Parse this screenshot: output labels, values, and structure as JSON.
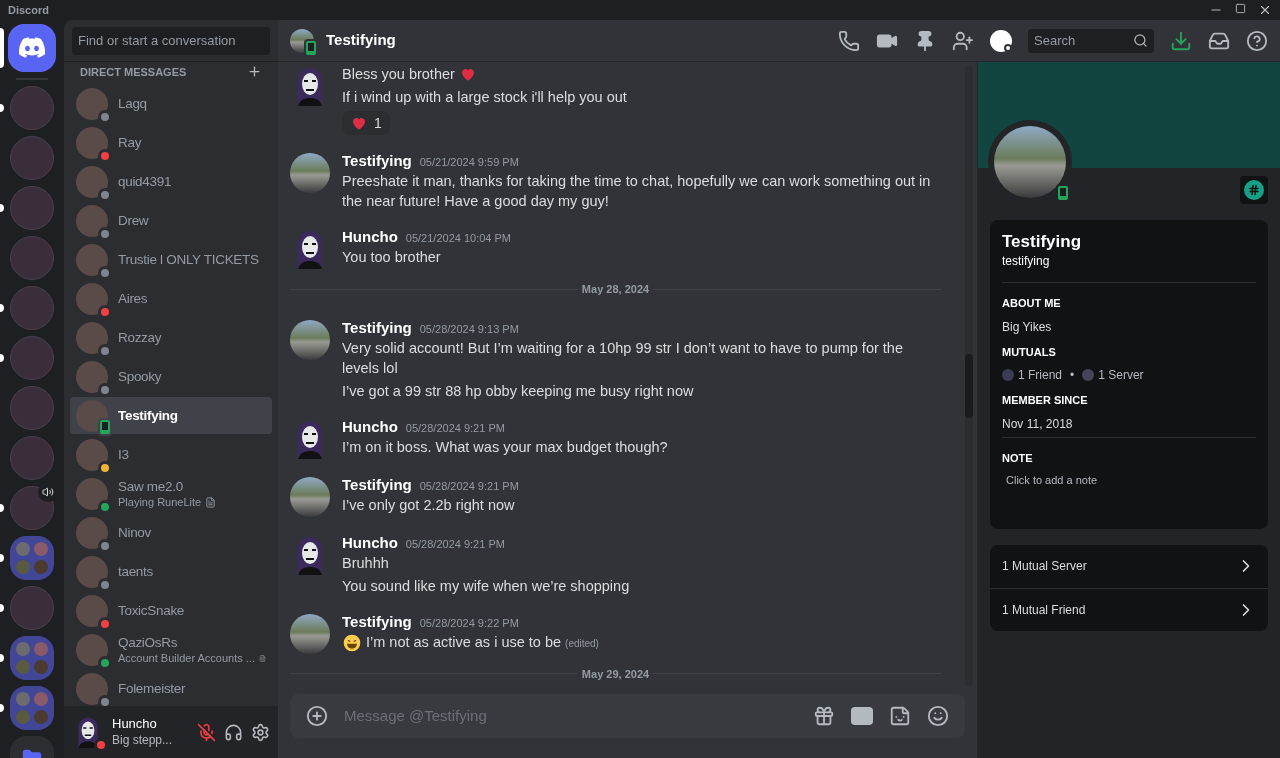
{
  "app_title": "Discord",
  "servers": [
    {
      "kind": "home",
      "selected": true,
      "unread": false,
      "voice": false
    },
    {
      "kind": "server",
      "selected": false,
      "unread": true,
      "voice": false
    },
    {
      "kind": "server",
      "selected": false,
      "unread": false,
      "voice": false
    },
    {
      "kind": "server",
      "selected": false,
      "unread": true,
      "voice": false
    },
    {
      "kind": "server",
      "selected": false,
      "unread": false,
      "voice": false
    },
    {
      "kind": "server",
      "selected": false,
      "unread": true,
      "voice": false
    },
    {
      "kind": "server",
      "selected": false,
      "unread": true,
      "voice": false
    },
    {
      "kind": "server",
      "selected": false,
      "unread": false,
      "voice": false
    },
    {
      "kind": "server",
      "selected": false,
      "unread": false,
      "voice": false
    },
    {
      "kind": "server",
      "selected": false,
      "unread": true,
      "voice": true
    },
    {
      "kind": "folder",
      "selected": false,
      "unread": true,
      "voice": false
    },
    {
      "kind": "server",
      "selected": false,
      "unread": true,
      "voice": false
    },
    {
      "kind": "folder",
      "selected": false,
      "unread": true,
      "voice": false
    },
    {
      "kind": "folder",
      "selected": false,
      "unread": true,
      "voice": false
    },
    {
      "kind": "closed-folder",
      "selected": false,
      "unread": false,
      "voice": false
    }
  ],
  "dm_search": {
    "placeholder": "Find or start a conversation"
  },
  "dm_header": "DIRECT MESSAGES",
  "dms": [
    {
      "name": "Lagq",
      "color": "#80848e",
      "on_mobile": false,
      "selected": false
    },
    {
      "name": "Ray",
      "color": "#f23f43",
      "on_mobile": false,
      "selected": false
    },
    {
      "name": "quid4391",
      "color": "#80848e",
      "on_mobile": false,
      "selected": false
    },
    {
      "name": "Drew",
      "color": "#80848e",
      "on_mobile": false,
      "selected": false
    },
    {
      "name": "Trustie l ONLY TICKETS",
      "color": "#80848e",
      "on_mobile": false,
      "selected": false
    },
    {
      "name": "Aires",
      "color": "#f23f43",
      "on_mobile": false,
      "selected": false
    },
    {
      "name": "Rozzay",
      "color": "#80848e",
      "on_mobile": false,
      "selected": false
    },
    {
      "name": "Spooky",
      "color": "#80848e",
      "on_mobile": false,
      "selected": false
    },
    {
      "name": "Testifying",
      "color": "#23a55a",
      "on_mobile": true,
      "selected": true
    },
    {
      "name": "I3",
      "color": "#f0b232",
      "on_mobile": false,
      "selected": false
    },
    {
      "name": "Saw me2.0",
      "color": "#23a55a",
      "on_mobile": false,
      "selected": false,
      "activity": "Playing RuneLite"
    },
    {
      "name": "Ninov",
      "color": "#80848e",
      "on_mobile": false,
      "selected": false
    },
    {
      "name": "taents",
      "color": "#80848e",
      "on_mobile": false,
      "selected": false
    },
    {
      "name": "ToxicSnake",
      "color": "#f23f43",
      "on_mobile": false,
      "selected": false
    },
    {
      "name": "QaziOsRs",
      "color": "#23a55a",
      "on_mobile": false,
      "selected": false,
      "activity": "Account Builder Accounts ..."
    },
    {
      "name": "Folemeister",
      "color": "#80848e",
      "on_mobile": false,
      "selected": false
    }
  ],
  "user_panel": {
    "name": "Huncho",
    "color": "#f23f43",
    "custom_status": "Big stepp...",
    "mic_muted": true
  },
  "header": {
    "title": "Testifying",
    "on_mobile": true,
    "search_placeholder": "Search"
  },
  "messages": [
    {
      "kind": "group",
      "avatar": {
        "kind": "mask"
      },
      "lines": [
        {
          "text": "Bless you brother",
          "emoji_after": {
            "kind": "heart"
          }
        },
        {
          "text": "If i wind up with a large stock i'll help you out"
        }
      ],
      "reactions": [
        {
          "emoji": {
            "kind": "heart"
          },
          "count": "1"
        }
      ]
    },
    {
      "kind": "group",
      "avatar": {
        "kind": "bike"
      },
      "author": "Testifying",
      "time": "05/21/2024 9:59 PM",
      "lines": [
        {
          "text": "Preeshate it man, thanks for taking the time to chat, hopefully we can work something out in the near future! Have a good day my guy!"
        }
      ]
    },
    {
      "kind": "group",
      "avatar": {
        "kind": "mask"
      },
      "author": "Huncho",
      "time": "05/21/2024 10:04 PM",
      "lines": [
        {
          "text": "You too brother"
        }
      ]
    },
    {
      "kind": "divider",
      "label": "May 28, 2024"
    },
    {
      "kind": "group",
      "avatar": {
        "kind": "bike"
      },
      "author": "Testifying",
      "time": "05/28/2024 9:13 PM",
      "lines": [
        {
          "text": "Very solid account! But I’m waiting for a 10hp 99 str I don’t want to have to pump for the levels lol"
        },
        {
          "text": "I’ve got a 99 str 88 hp obby keeping me busy right now"
        }
      ]
    },
    {
      "kind": "group",
      "avatar": {
        "kind": "mask"
      },
      "author": "Huncho",
      "time": "05/28/2024 9:21 PM",
      "lines": [
        {
          "text": "I’m on it boss. What was your max budget though?"
        }
      ]
    },
    {
      "kind": "group",
      "avatar": {
        "kind": "bike"
      },
      "author": "Testifying",
      "time": "05/28/2024 9:21 PM",
      "lines": [
        {
          "text": "I’ve only got 2.2b right now"
        }
      ]
    },
    {
      "kind": "group",
      "avatar": {
        "kind": "mask"
      },
      "author": "Huncho",
      "time": "05/28/2024 9:21 PM",
      "lines": [
        {
          "text": "Bruhhh"
        },
        {
          "text": "You sound like my wife when we’re shopping"
        }
      ]
    },
    {
      "kind": "group",
      "avatar": {
        "kind": "bike"
      },
      "author": "Testifying",
      "time": "05/28/2024 9:22 PM",
      "lines": [
        {
          "text": "I’m not as active as i use to be",
          "emoji_before": {
            "kind": "laugh"
          },
          "edited": "(edited)"
        }
      ]
    },
    {
      "kind": "divider",
      "label": "May 29, 2024"
    }
  ],
  "composer": {
    "placeholder": "Message @Testifying"
  },
  "profile": {
    "display_name": "Testifying",
    "username": "testifying",
    "on_mobile": true,
    "sections": [
      {
        "kind": "text",
        "label": "ABOUT ME",
        "value": "Big Yikes"
      },
      {
        "kind": "mutuals",
        "label": "MUTUALS",
        "friends": "1 Friend",
        "separator": "•",
        "servers": "1 Server"
      },
      {
        "kind": "text",
        "label": "MEMBER SINCE",
        "value": "Nov 11, 2018"
      },
      {
        "kind": "note",
        "label": "NOTE",
        "placeholder": "Click to add a note"
      }
    ],
    "links": [
      "1 Mutual Server",
      "1 Mutual Friend"
    ]
  }
}
